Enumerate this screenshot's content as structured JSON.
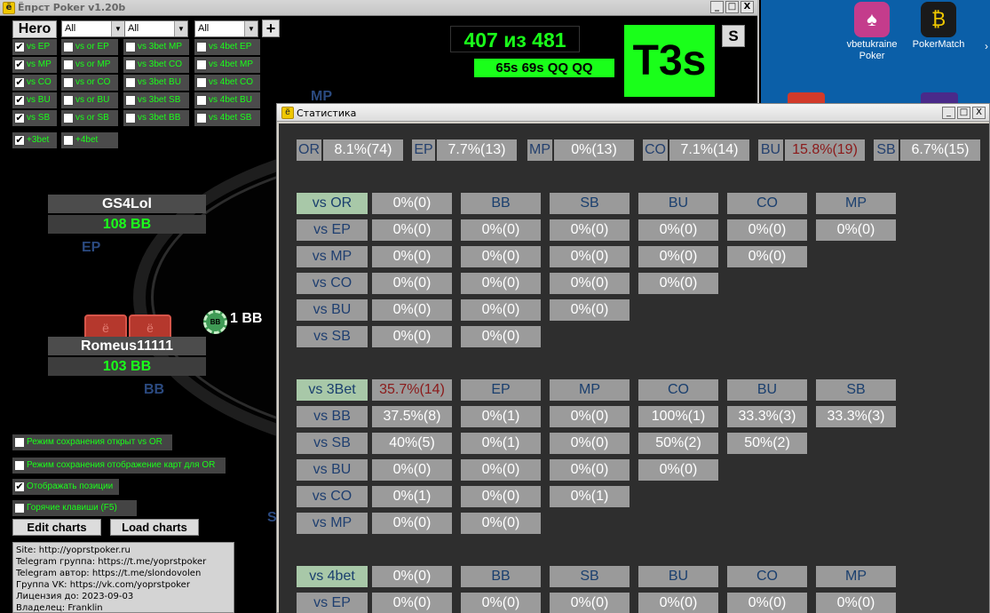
{
  "app": {
    "title": "Ёпрст Poker v1.20b",
    "icon_glyph": "ё",
    "window_buttons": [
      "_",
      "□",
      "X"
    ],
    "hero_label": "Hero",
    "plus_label": "+",
    "s_label": "S",
    "selects": [
      "All",
      "All",
      "All"
    ],
    "filters": {
      "col1": [
        "vs EP",
        "vs MP",
        "vs CO",
        "vs BU",
        "vs SB",
        "+3bet"
      ],
      "col2": [
        "vs or EP",
        "vs or MP",
        "vs or CO",
        "vs or BU",
        "vs or SB",
        "+4bet"
      ],
      "col3": [
        "vs 3bet MP",
        "vs 3bet CO",
        "vs 3bet BU",
        "vs 3bet SB",
        "vs 3bet BB"
      ],
      "col4": [
        "vs 4bet EP",
        "vs 4bet MP",
        "vs 4bet CO",
        "vs 4bet BU",
        "vs 4bet SB"
      ]
    },
    "counter": "407 из 481",
    "hands": "65s  69s  QQ  QQ",
    "current_hand": "T3s",
    "players": [
      {
        "name": "GS4Lol",
        "stack": "108 BB",
        "position": "EP"
      },
      {
        "name": "Romeus11111",
        "stack": "103 BB",
        "position": "BB"
      }
    ],
    "table_positions": {
      "mp": "MP",
      "s": "S"
    },
    "card_glyph": "ё",
    "chip_label": "BB",
    "pot": "1 BB",
    "options": [
      "Режим сохранения открыт vs OR",
      "Режим сохранения отображение карт для OR",
      "Отображать позиции",
      "Горячие клавиши (F5)"
    ],
    "edit_charts": "Edit charts",
    "load_charts": "Load charts",
    "info": [
      "Site: http://yoprstpoker.ru",
      "Telegram группа: https://t.me/yoprstpoker",
      "Telegram автор: https://t.me/slondovolen",
      "Группа VK: https://vk.com/yoprstpoker",
      "Лицензия до: 2023-09-03",
      "Владелец: Franklin"
    ]
  },
  "desktop": {
    "icons": [
      {
        "label": "vbetukraine Poker",
        "glyph": "♠",
        "color": "#c43c8c"
      },
      {
        "label": "PokerMatch",
        "glyph": "₿",
        "color": "#1a1a1a"
      }
    ],
    "scroll_arrow": "›"
  },
  "stats": {
    "title": "Статистика",
    "open_raise": [
      {
        "tag": "OR",
        "value": "8.1%(74)"
      },
      {
        "tag": "EP",
        "value": "7.7%(13)"
      },
      {
        "tag": "MP",
        "value": "0%(13)"
      },
      {
        "tag": "CO",
        "value": "7.1%(14)"
      },
      {
        "tag": "BU",
        "value": "15.8%(19)"
      },
      {
        "tag": "SB",
        "value": "6.7%(15)"
      }
    ],
    "vs_or": {
      "label": "vs OR",
      "total": "0%(0)",
      "headers": [
        "BB",
        "SB",
        "BU",
        "CO",
        "MP"
      ],
      "rows": [
        {
          "label": "vs EP",
          "cells": [
            "0%(0)",
            "0%(0)",
            "0%(0)",
            "0%(0)",
            "0%(0)",
            "0%(0)"
          ]
        },
        {
          "label": "vs MP",
          "cells": [
            "0%(0)",
            "0%(0)",
            "0%(0)",
            "0%(0)",
            "0%(0)"
          ]
        },
        {
          "label": "vs CO",
          "cells": [
            "0%(0)",
            "0%(0)",
            "0%(0)",
            "0%(0)"
          ]
        },
        {
          "label": "vs BU",
          "cells": [
            "0%(0)",
            "0%(0)",
            "0%(0)"
          ]
        },
        {
          "label": "vs SB",
          "cells": [
            "0%(0)",
            "0%(0)"
          ]
        }
      ]
    },
    "vs_3bet": {
      "label": "vs 3Bet",
      "total": "35.7%(14)",
      "headers": [
        "EP",
        "MP",
        "CO",
        "BU",
        "SB"
      ],
      "rows": [
        {
          "label": "vs BB",
          "cells": [
            "37.5%(8)",
            "0%(1)",
            "0%(0)",
            "100%(1)",
            "33.3%(3)",
            "33.3%(3)"
          ]
        },
        {
          "label": "vs SB",
          "cells": [
            "40%(5)",
            "0%(1)",
            "0%(0)",
            "50%(2)",
            "50%(2)"
          ]
        },
        {
          "label": "vs BU",
          "cells": [
            "0%(0)",
            "0%(0)",
            "0%(0)",
            "0%(0)"
          ]
        },
        {
          "label": "vs CO",
          "cells": [
            "0%(1)",
            "0%(0)",
            "0%(1)"
          ]
        },
        {
          "label": "vs MP",
          "cells": [
            "0%(0)",
            "0%(0)"
          ]
        }
      ]
    },
    "vs_4bet": {
      "label": "vs 4bet",
      "total": "0%(0)",
      "headers": [
        "BB",
        "SB",
        "BU",
        "CO",
        "MP"
      ],
      "rows": [
        {
          "label": "vs EP",
          "cells": [
            "0%(0)",
            "0%(0)",
            "0%(0)",
            "0%(0)",
            "0%(0)",
            "0%(0)"
          ]
        }
      ]
    }
  }
}
